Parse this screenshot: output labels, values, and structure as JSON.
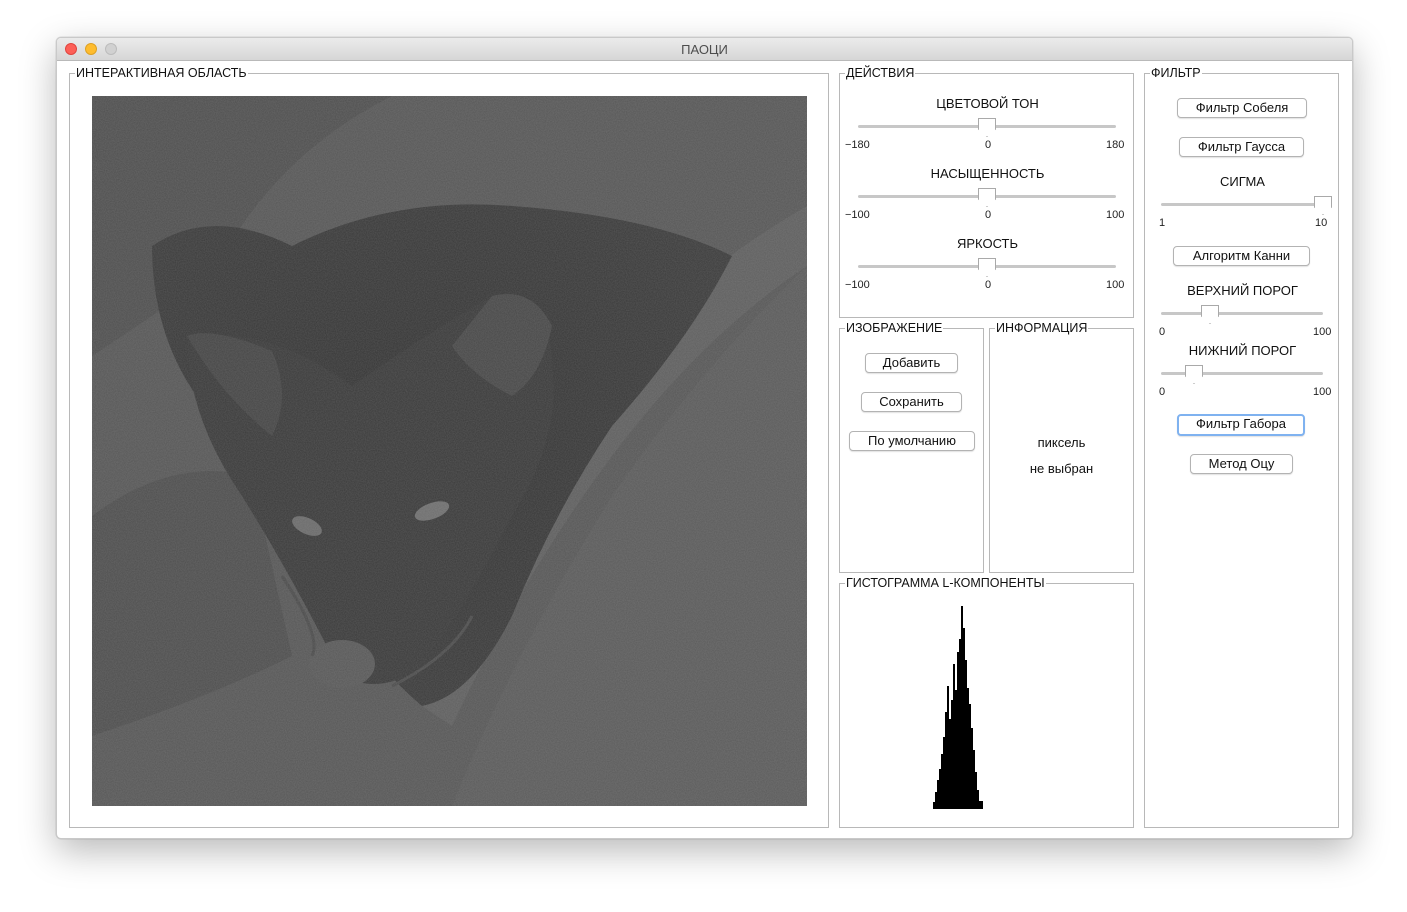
{
  "window": {
    "title": "ПАОЦИ"
  },
  "interactive": {
    "title": "ИНТЕРАКТИВНАЯ ОБЛАСТЬ"
  },
  "actions": {
    "title": "ДЕЙСТВИЯ",
    "hue": {
      "label": "ЦВЕТОВОЙ ТОН",
      "min": "−180",
      "mid": "0",
      "max": "180",
      "value": 0,
      "range": [
        -180,
        180
      ]
    },
    "saturation": {
      "label": "НАСЫЩЕННОСТЬ",
      "min": "−100",
      "mid": "0",
      "max": "100",
      "value": 0,
      "range": [
        -100,
        100
      ]
    },
    "brightness": {
      "label": "ЯРКОСТЬ",
      "min": "−100",
      "mid": "0",
      "max": "100",
      "value": 0,
      "range": [
        -100,
        100
      ]
    }
  },
  "image": {
    "title": "ИЗОБРАЖЕНИЕ",
    "add": "Добавить",
    "save": "Сохранить",
    "default": "По умолчанию"
  },
  "info": {
    "title": "ИНФОРМАЦИЯ",
    "line1": "пиксель",
    "line2": "не выбран"
  },
  "histogram": {
    "title": "ГИСТОГРАММА L-КОМПОНЕНТЫ"
  },
  "filter": {
    "title": "ФИЛЬТР",
    "sobel": "Фильтр Собеля",
    "gauss": "Фильтр Гаусса",
    "sigma": {
      "label": "СИГМА",
      "min": "1",
      "max": "10",
      "value": 10,
      "range": [
        1,
        10
      ]
    },
    "canny": "Алгоритм Канни",
    "upper": {
      "label": "ВЕРХНИЙ ПОРОГ",
      "min": "0",
      "max": "100",
      "value": 30,
      "range": [
        0,
        100
      ]
    },
    "lower": {
      "label": "НИЖНИЙ ПОРОГ",
      "min": "0",
      "max": "100",
      "value": 20,
      "range": [
        0,
        100
      ]
    },
    "gabor": "Фильтр Габора",
    "otsu": "Метод Оцу"
  },
  "colors": {
    "track": "#c7c7c7",
    "focus": "#7fb2f0",
    "image_bg": "#4f4f4f"
  }
}
